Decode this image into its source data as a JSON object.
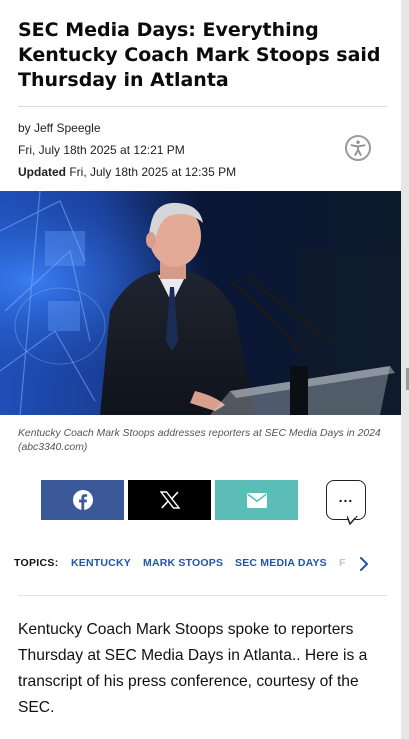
{
  "article": {
    "headline": "SEC Media Days: Everything Kentucky Coach Mark Stoops said Thursday in Atlanta",
    "byline": "by Jeff Speegle",
    "published": "Fri, July 18th 2025 at 12:21 PM",
    "updated_label": "Updated",
    "updated": "Fri, July 18th 2025 at 12:35 PM",
    "image_caption": "Kentucky Coach Mark Stoops addresses reporters at SEC Media Days in 2024 (abc3340.com)",
    "body": "Kentucky Coach Mark Stoops spoke to reporters Thursday at SEC Media Days in Atlanta.. Here is a transcript of his press conference, courtesy of the SEC."
  },
  "accessibility": {
    "icon": "accessibility-icon"
  },
  "share": {
    "buttons": [
      {
        "name": "facebook",
        "icon": "facebook-icon",
        "color": "#3b5998"
      },
      {
        "name": "x",
        "icon": "x-icon",
        "color": "#000000"
      },
      {
        "name": "email",
        "icon": "mail-icon",
        "color": "#5cbcb8"
      },
      {
        "name": "more",
        "icon": "more-icon",
        "label": "..."
      }
    ]
  },
  "topics": {
    "label": "TOPICS:",
    "items": [
      "KENTUCKY",
      "MARK STOOPS",
      "SEC MEDIA DAYS",
      "F"
    ]
  },
  "colors": {
    "link": "#1f56a8",
    "facebook": "#3b5998",
    "email": "#5cbcb8"
  }
}
